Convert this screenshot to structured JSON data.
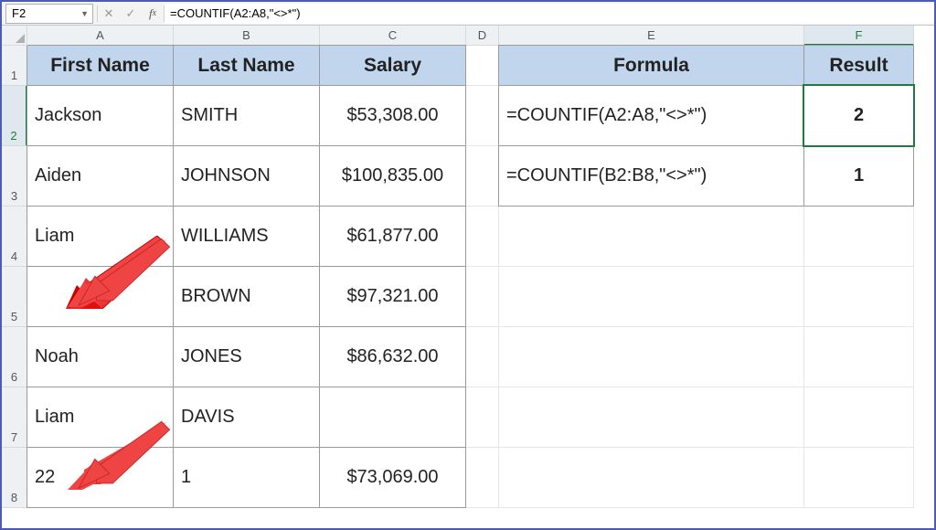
{
  "namebox": "F2",
  "formula_bar": "=COUNTIF(A2:A8,\"<>*\")",
  "columns": [
    "A",
    "B",
    "C",
    "D",
    "E",
    "F"
  ],
  "rows": [
    "1",
    "2",
    "3",
    "4",
    "5",
    "6",
    "7",
    "8"
  ],
  "headers": {
    "A": "First Name",
    "B": "Last Name",
    "C": "Salary",
    "E": "Formula",
    "F": "Result"
  },
  "table": [
    {
      "first": "Jackson",
      "last": "SMITH",
      "salary": "$53,308.00"
    },
    {
      "first": "Aiden",
      "last": "JOHNSON",
      "salary": "$100,835.00"
    },
    {
      "first": "Liam",
      "last": "WILLIAMS",
      "salary": "$61,877.00"
    },
    {
      "first": "",
      "last": "BROWN",
      "salary": "$97,321.00"
    },
    {
      "first": "Noah",
      "last": "JONES",
      "salary": "$86,632.00"
    },
    {
      "first": "Liam",
      "last": "DAVIS",
      "salary": ""
    },
    {
      "first": "22",
      "last": "1",
      "salary": "$73,069.00"
    }
  ],
  "formulas": [
    {
      "text": "=COUNTIF(A2:A8,\"<>*\")",
      "result": "2"
    },
    {
      "text": "=COUNTIF(B2:B8,\"<>*\")",
      "result": "1"
    }
  ]
}
